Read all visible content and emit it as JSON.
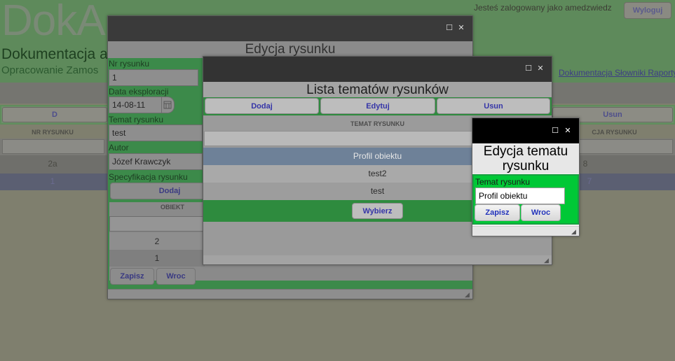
{
  "background": {
    "logo": "DokA",
    "subtitle": "Dokumentacja a",
    "opracowanie": "Opracowanie Zamos",
    "logged_in": "Jesteś zalogowany jako amedzwiedz",
    "logout_label": "Wyloguj",
    "nav_links": "Dokumentacja  Słowniki  Raporty",
    "toolbar": {
      "left_label": "D",
      "right_label": "Usun"
    },
    "columns": {
      "nr_rysunku": "NR RYSUNKU",
      "right_col": "CJA RYSUNKU"
    },
    "rows": [
      {
        "nr": "2a",
        "right": "8"
      },
      {
        "nr": "1",
        "right": "7"
      }
    ]
  },
  "dialog_edycja_rysunku": {
    "title": "Edycja rysunku",
    "fields": {
      "nr_rysunku_label": "Nr rysunku",
      "nr_rysunku_value": "1",
      "data_label": "Data eksploracji",
      "data_value": "14-08-11",
      "temat_label": "Temat rysunku",
      "temat_value": "test",
      "autor_label": "Autor",
      "autor_value": "Józef Krawczyk",
      "spec_label": "Specyfikacja rysunku"
    },
    "dodaj_label": "Dodaj",
    "table": {
      "header": "OBIEKT",
      "rows": [
        "2",
        "1"
      ]
    },
    "zapisz_label": "Zapisz",
    "wroc_label": "Wroc"
  },
  "dialog_lista_tematow": {
    "title": "Lista tematów rysunków",
    "toolbar": {
      "dodaj": "Dodaj",
      "edytuj": "Edytuj",
      "usun": "Usun"
    },
    "column_header": "TEMAT RYSUNKU",
    "rows": [
      "Profil obiektu",
      "test2",
      "test"
    ],
    "wybierz_label": "Wybierz"
  },
  "dialog_edycja_tematu": {
    "title": "Edycja tematu rysunku",
    "temat_label": "Temat rysunku",
    "temat_value": "Profil obiektu",
    "zapisz_label": "Zapisz",
    "wroc_label": "Wroc"
  },
  "window_controls": {
    "maximize_glyph": "☐",
    "close_glyph": "✕",
    "grip_glyph": "◢"
  }
}
